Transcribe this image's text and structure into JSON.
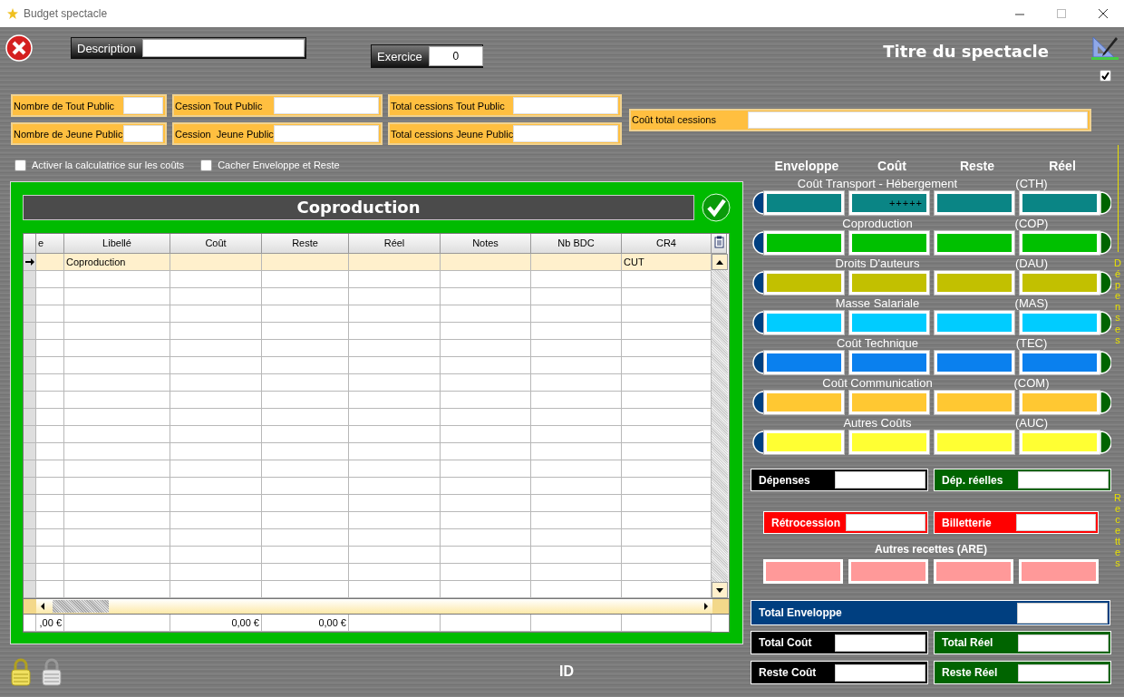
{
  "window": {
    "title": "Budget spectacle"
  },
  "description": {
    "label": "Description"
  },
  "exercice": {
    "label": "Exercice",
    "value": "0"
  },
  "show_title": "Titre du spectacle",
  "top_checkbox": {
    "checked": true
  },
  "cession_fields": [
    {
      "label": "Nombre de Tout Public"
    },
    {
      "label": "Cession Tout Public"
    },
    {
      "label": "Total cessions Tout Public"
    },
    {
      "label": "Nombre de Jeune Public"
    },
    {
      "label": "Cession  Jeune Public"
    },
    {
      "label": "Total cessions Jeune Public"
    }
  ],
  "total_cessions": {
    "label": "Coût total cessions"
  },
  "options": [
    {
      "label": "Activer la calculatrice sur les coûts",
      "checked": false
    },
    {
      "label": "Cacher Enveloppe et Reste",
      "checked": false
    }
  ],
  "panel": {
    "title": "Coproduction",
    "table": {
      "columns": [
        "e",
        "Libellé",
        "Coût",
        "Reste",
        "Réel",
        "Notes",
        "Nb BDC",
        "CR4"
      ],
      "rows": [
        {
          "libelle": "Coproduction",
          "cr4": "CUT",
          "selected": true
        }
      ],
      "totals": {
        "col_e": ",00 €",
        "cout": "0,00 €",
        "reste": "0,00 €"
      }
    }
  },
  "footer": {
    "label": "ID"
  },
  "column_headers": [
    "Enveloppe",
    "Coût",
    "Reste",
    "Réel"
  ],
  "categories": [
    {
      "name": "Coût Transport - Hébergement",
      "code": "(CTH)",
      "color": "#0a8585",
      "cout_value": "+++++"
    },
    {
      "name": "Coproduction",
      "code": "(COP)",
      "color": "#00c000"
    },
    {
      "name": "Droits D'auteurs",
      "code": "(DAU)",
      "color": "#c2c000"
    },
    {
      "name": "Masse Salariale",
      "code": "(MAS)",
      "color": "#00ccff"
    },
    {
      "name": "Coût Technique",
      "code": "(TEC)",
      "color": "#0a80ee"
    },
    {
      "name": "Coût Communication",
      "code": "(COM)",
      "color": "#ffc832"
    },
    {
      "name": "Autres Coûts",
      "code": "(AUC)",
      "color": "#ffff33"
    }
  ],
  "summary": [
    {
      "label": "Dépenses",
      "color": "#000000"
    },
    {
      "label": "Dép. réelles",
      "color": "#006400"
    }
  ],
  "receipts": [
    {
      "label": "Rétrocession",
      "color": "#ff0000"
    },
    {
      "label": "Billetterie",
      "color": "#ff0000"
    }
  ],
  "other_receipts": {
    "label": "Autres recettes (ARE)"
  },
  "totals": [
    {
      "label": "Total Enveloppe",
      "color": "#003f80"
    },
    {
      "label": "Total Coût",
      "color": "#000000"
    },
    {
      "label": "Total Réel",
      "color": "#006400"
    },
    {
      "label": "Reste Coût",
      "color": "#000000"
    },
    {
      "label": "Reste Réel",
      "color": "#006400"
    }
  ],
  "side_labels": {
    "expenses": "Dépenses",
    "receipts": "Recettes"
  }
}
